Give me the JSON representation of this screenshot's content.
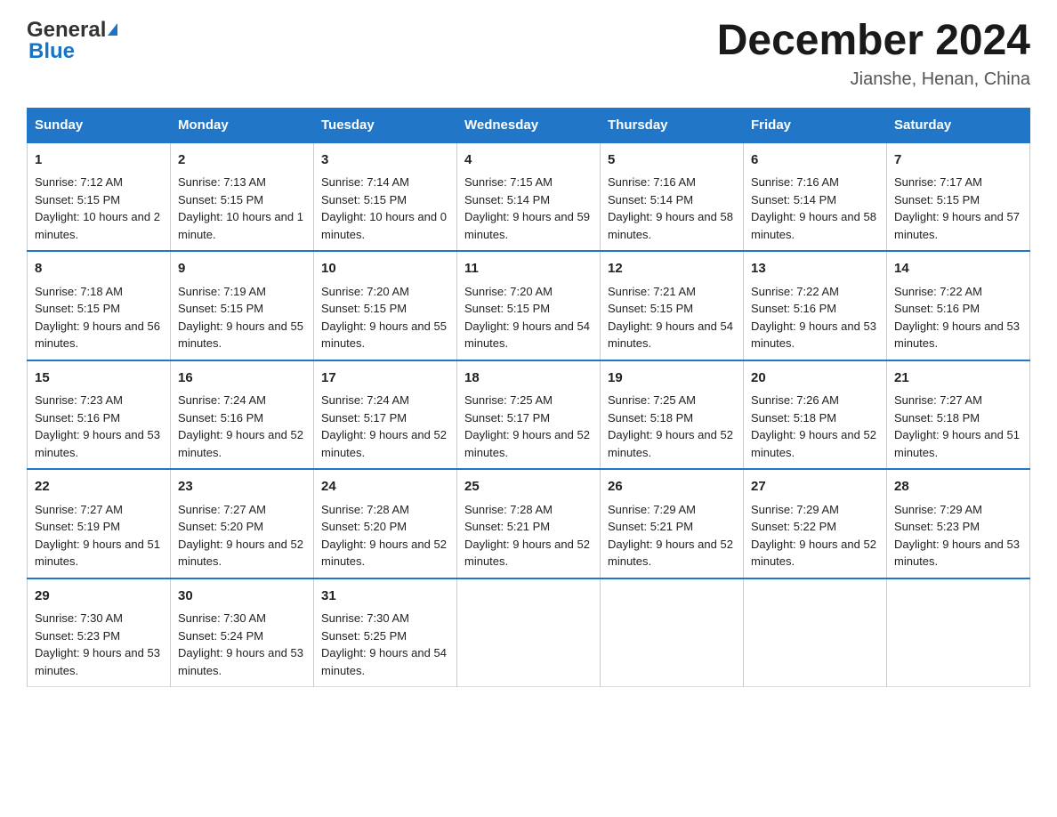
{
  "header": {
    "logo_general": "General",
    "logo_blue": "Blue",
    "title": "December 2024",
    "subtitle": "Jianshe, Henan, China"
  },
  "days_of_week": [
    "Sunday",
    "Monday",
    "Tuesday",
    "Wednesday",
    "Thursday",
    "Friday",
    "Saturday"
  ],
  "weeks": [
    [
      {
        "day": "1",
        "sunrise": "7:12 AM",
        "sunset": "5:15 PM",
        "daylight": "10 hours and 2 minutes."
      },
      {
        "day": "2",
        "sunrise": "7:13 AM",
        "sunset": "5:15 PM",
        "daylight": "10 hours and 1 minute."
      },
      {
        "day": "3",
        "sunrise": "7:14 AM",
        "sunset": "5:15 PM",
        "daylight": "10 hours and 0 minutes."
      },
      {
        "day": "4",
        "sunrise": "7:15 AM",
        "sunset": "5:14 PM",
        "daylight": "9 hours and 59 minutes."
      },
      {
        "day": "5",
        "sunrise": "7:16 AM",
        "sunset": "5:14 PM",
        "daylight": "9 hours and 58 minutes."
      },
      {
        "day": "6",
        "sunrise": "7:16 AM",
        "sunset": "5:14 PM",
        "daylight": "9 hours and 58 minutes."
      },
      {
        "day": "7",
        "sunrise": "7:17 AM",
        "sunset": "5:15 PM",
        "daylight": "9 hours and 57 minutes."
      }
    ],
    [
      {
        "day": "8",
        "sunrise": "7:18 AM",
        "sunset": "5:15 PM",
        "daylight": "9 hours and 56 minutes."
      },
      {
        "day": "9",
        "sunrise": "7:19 AM",
        "sunset": "5:15 PM",
        "daylight": "9 hours and 55 minutes."
      },
      {
        "day": "10",
        "sunrise": "7:20 AM",
        "sunset": "5:15 PM",
        "daylight": "9 hours and 55 minutes."
      },
      {
        "day": "11",
        "sunrise": "7:20 AM",
        "sunset": "5:15 PM",
        "daylight": "9 hours and 54 minutes."
      },
      {
        "day": "12",
        "sunrise": "7:21 AM",
        "sunset": "5:15 PM",
        "daylight": "9 hours and 54 minutes."
      },
      {
        "day": "13",
        "sunrise": "7:22 AM",
        "sunset": "5:16 PM",
        "daylight": "9 hours and 53 minutes."
      },
      {
        "day": "14",
        "sunrise": "7:22 AM",
        "sunset": "5:16 PM",
        "daylight": "9 hours and 53 minutes."
      }
    ],
    [
      {
        "day": "15",
        "sunrise": "7:23 AM",
        "sunset": "5:16 PM",
        "daylight": "9 hours and 53 minutes."
      },
      {
        "day": "16",
        "sunrise": "7:24 AM",
        "sunset": "5:16 PM",
        "daylight": "9 hours and 52 minutes."
      },
      {
        "day": "17",
        "sunrise": "7:24 AM",
        "sunset": "5:17 PM",
        "daylight": "9 hours and 52 minutes."
      },
      {
        "day": "18",
        "sunrise": "7:25 AM",
        "sunset": "5:17 PM",
        "daylight": "9 hours and 52 minutes."
      },
      {
        "day": "19",
        "sunrise": "7:25 AM",
        "sunset": "5:18 PM",
        "daylight": "9 hours and 52 minutes."
      },
      {
        "day": "20",
        "sunrise": "7:26 AM",
        "sunset": "5:18 PM",
        "daylight": "9 hours and 52 minutes."
      },
      {
        "day": "21",
        "sunrise": "7:27 AM",
        "sunset": "5:18 PM",
        "daylight": "9 hours and 51 minutes."
      }
    ],
    [
      {
        "day": "22",
        "sunrise": "7:27 AM",
        "sunset": "5:19 PM",
        "daylight": "9 hours and 51 minutes."
      },
      {
        "day": "23",
        "sunrise": "7:27 AM",
        "sunset": "5:20 PM",
        "daylight": "9 hours and 52 minutes."
      },
      {
        "day": "24",
        "sunrise": "7:28 AM",
        "sunset": "5:20 PM",
        "daylight": "9 hours and 52 minutes."
      },
      {
        "day": "25",
        "sunrise": "7:28 AM",
        "sunset": "5:21 PM",
        "daylight": "9 hours and 52 minutes."
      },
      {
        "day": "26",
        "sunrise": "7:29 AM",
        "sunset": "5:21 PM",
        "daylight": "9 hours and 52 minutes."
      },
      {
        "day": "27",
        "sunrise": "7:29 AM",
        "sunset": "5:22 PM",
        "daylight": "9 hours and 52 minutes."
      },
      {
        "day": "28",
        "sunrise": "7:29 AM",
        "sunset": "5:23 PM",
        "daylight": "9 hours and 53 minutes."
      }
    ],
    [
      {
        "day": "29",
        "sunrise": "7:30 AM",
        "sunset": "5:23 PM",
        "daylight": "9 hours and 53 minutes."
      },
      {
        "day": "30",
        "sunrise": "7:30 AM",
        "sunset": "5:24 PM",
        "daylight": "9 hours and 53 minutes."
      },
      {
        "day": "31",
        "sunrise": "7:30 AM",
        "sunset": "5:25 PM",
        "daylight": "9 hours and 54 minutes."
      },
      null,
      null,
      null,
      null
    ]
  ]
}
